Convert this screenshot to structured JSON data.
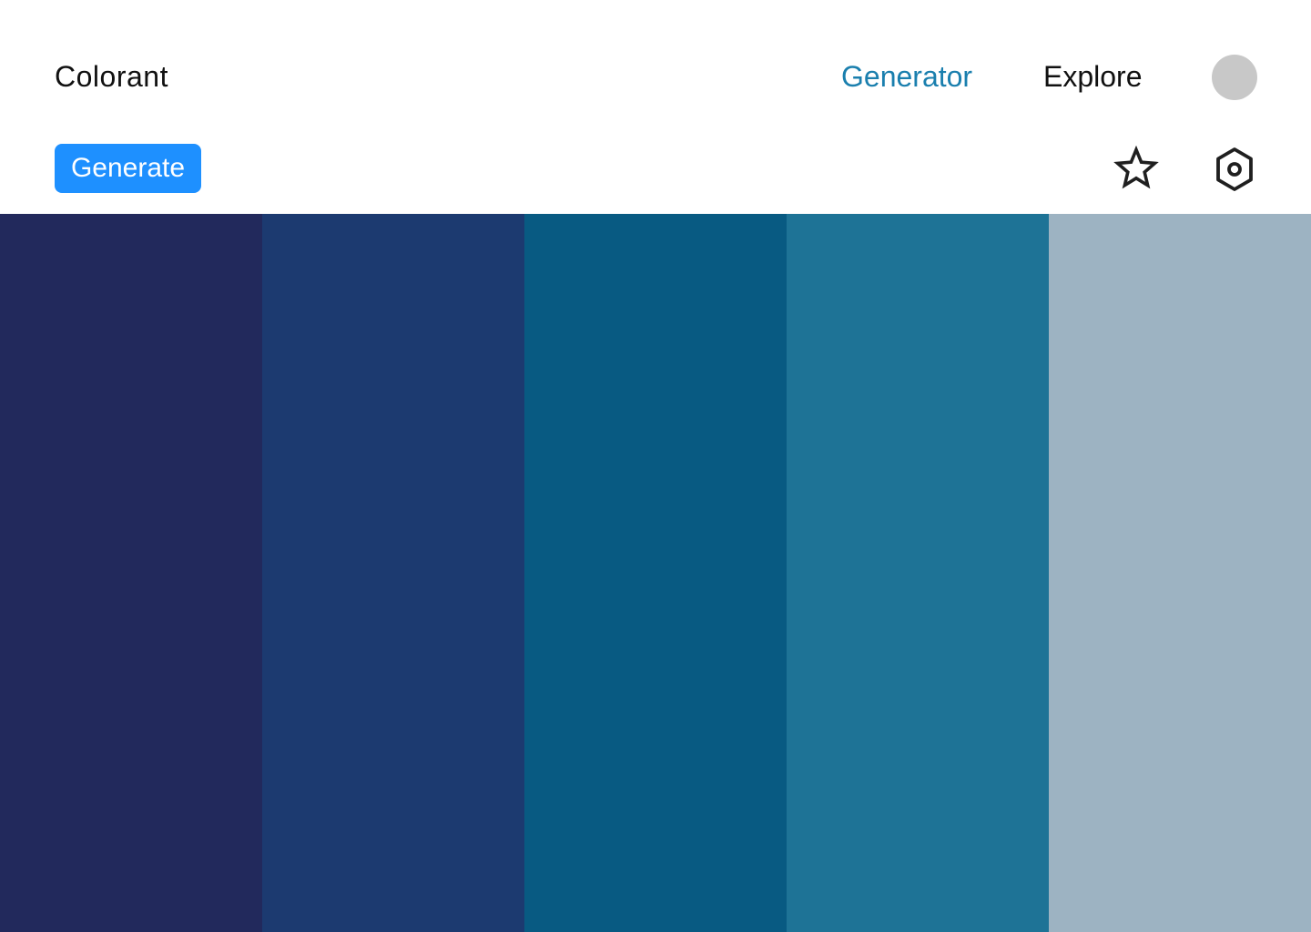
{
  "header": {
    "brand": "Colorant",
    "nav": [
      {
        "label": "Generator",
        "active": true,
        "color": "#1a7fae"
      },
      {
        "label": "Explore",
        "active": false,
        "color": "#111111"
      }
    ],
    "avatar_color": "#c8c8c8"
  },
  "toolbar": {
    "generate_label": "Generate",
    "generate_color": "#1e90ff",
    "icons": [
      "star-icon",
      "settings-hexagon-icon"
    ]
  },
  "palette": {
    "colors": [
      "#22295c",
      "#1c3a70",
      "#085a82",
      "#1e7396",
      "#9db3c2"
    ]
  }
}
